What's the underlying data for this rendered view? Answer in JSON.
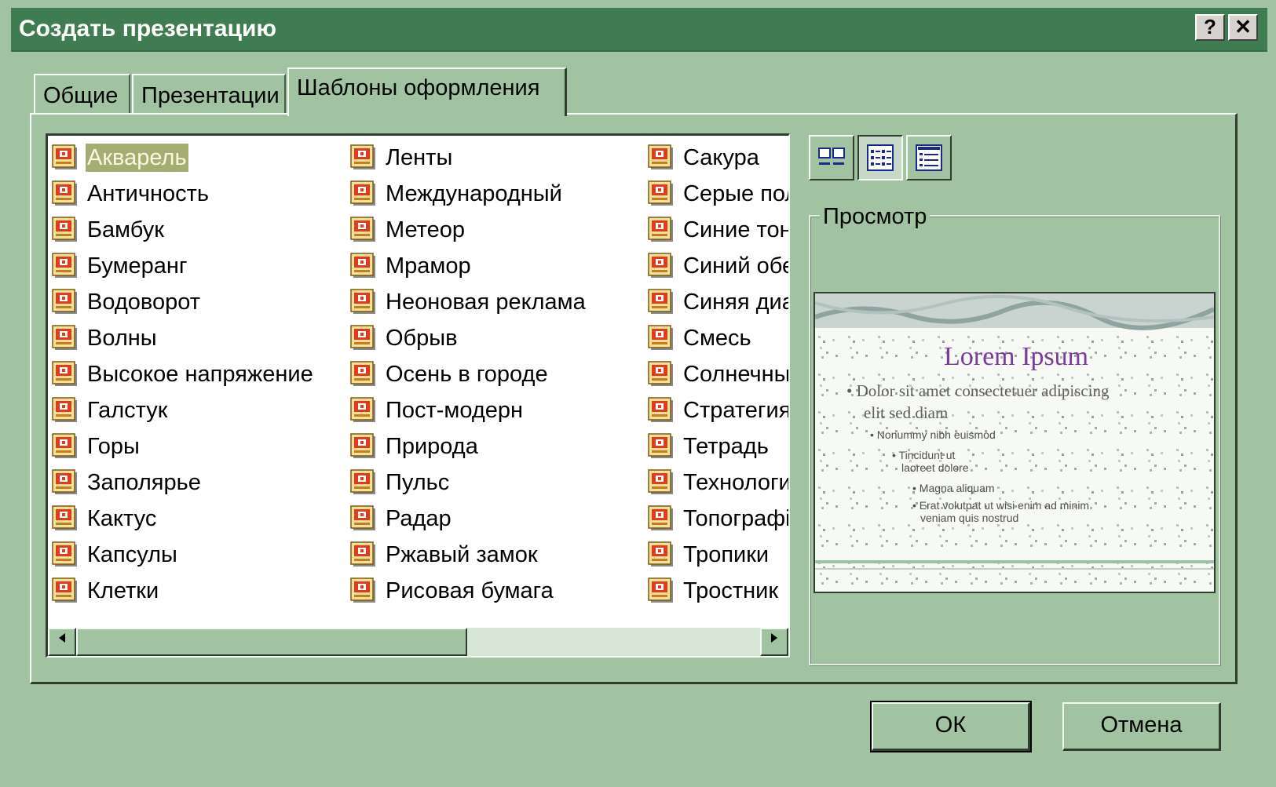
{
  "dialog": {
    "title": "Создать презентацию",
    "help_label": "?",
    "close_label": "✕"
  },
  "tabs": [
    {
      "label": "Общие"
    },
    {
      "label": "Презентации"
    },
    {
      "label": "Шаблоны оформления",
      "active": true
    }
  ],
  "templates": {
    "selected": "Акварель",
    "columns": [
      [
        "Акварель",
        "Античность",
        "Бамбук",
        "Бумеранг",
        "Водоворот",
        "Волны",
        "Высокое напряжение",
        "Галстук",
        "Горы",
        "Заполярье",
        "Кактус",
        "Капсулы",
        "Клетки"
      ],
      [
        "Ленты",
        "Международный",
        "Метеор",
        "Мрамор",
        "Неоновая реклама",
        "Обрыв",
        "Осень в городе",
        "Пост-модерн",
        "Природа",
        "Пульс",
        "Радар",
        "Ржавый замок",
        "Рисовая бумага"
      ],
      [
        "Сакура",
        "Серые пол",
        "Синие тон",
        "Синий обе",
        "Синяя диа",
        "Смесь",
        "Солнечны",
        "Стратегия",
        "Тетрадь",
        "Технологи",
        "Топографі",
        "Тропики",
        "Тростник"
      ]
    ]
  },
  "view_buttons": [
    {
      "name": "large-icons-view-icon"
    },
    {
      "name": "list-view-icon",
      "pressed": true
    },
    {
      "name": "details-view-icon"
    }
  ],
  "preview": {
    "label": "Просмотр",
    "slide_title": "Lorem Ipsum",
    "line1": "• Dolor sit amet consectetuer adipiscing",
    "line2": "elit sed diam",
    "line3": "• Nonummy nibh euismod",
    "line4": "• Tincidunt ut",
    "line5": "laoreet dolore",
    "line6": "• Magna aliquam",
    "line7": "• Erat volutpat ut wisi enim ad minim",
    "line8": "veniam quis nostrud"
  },
  "buttons": {
    "ok": "ОК",
    "cancel": "Отмена"
  },
  "colors": {
    "background": "#a2c3a2",
    "titlebar": "#3f7c51",
    "selection": "#a6ad73"
  }
}
